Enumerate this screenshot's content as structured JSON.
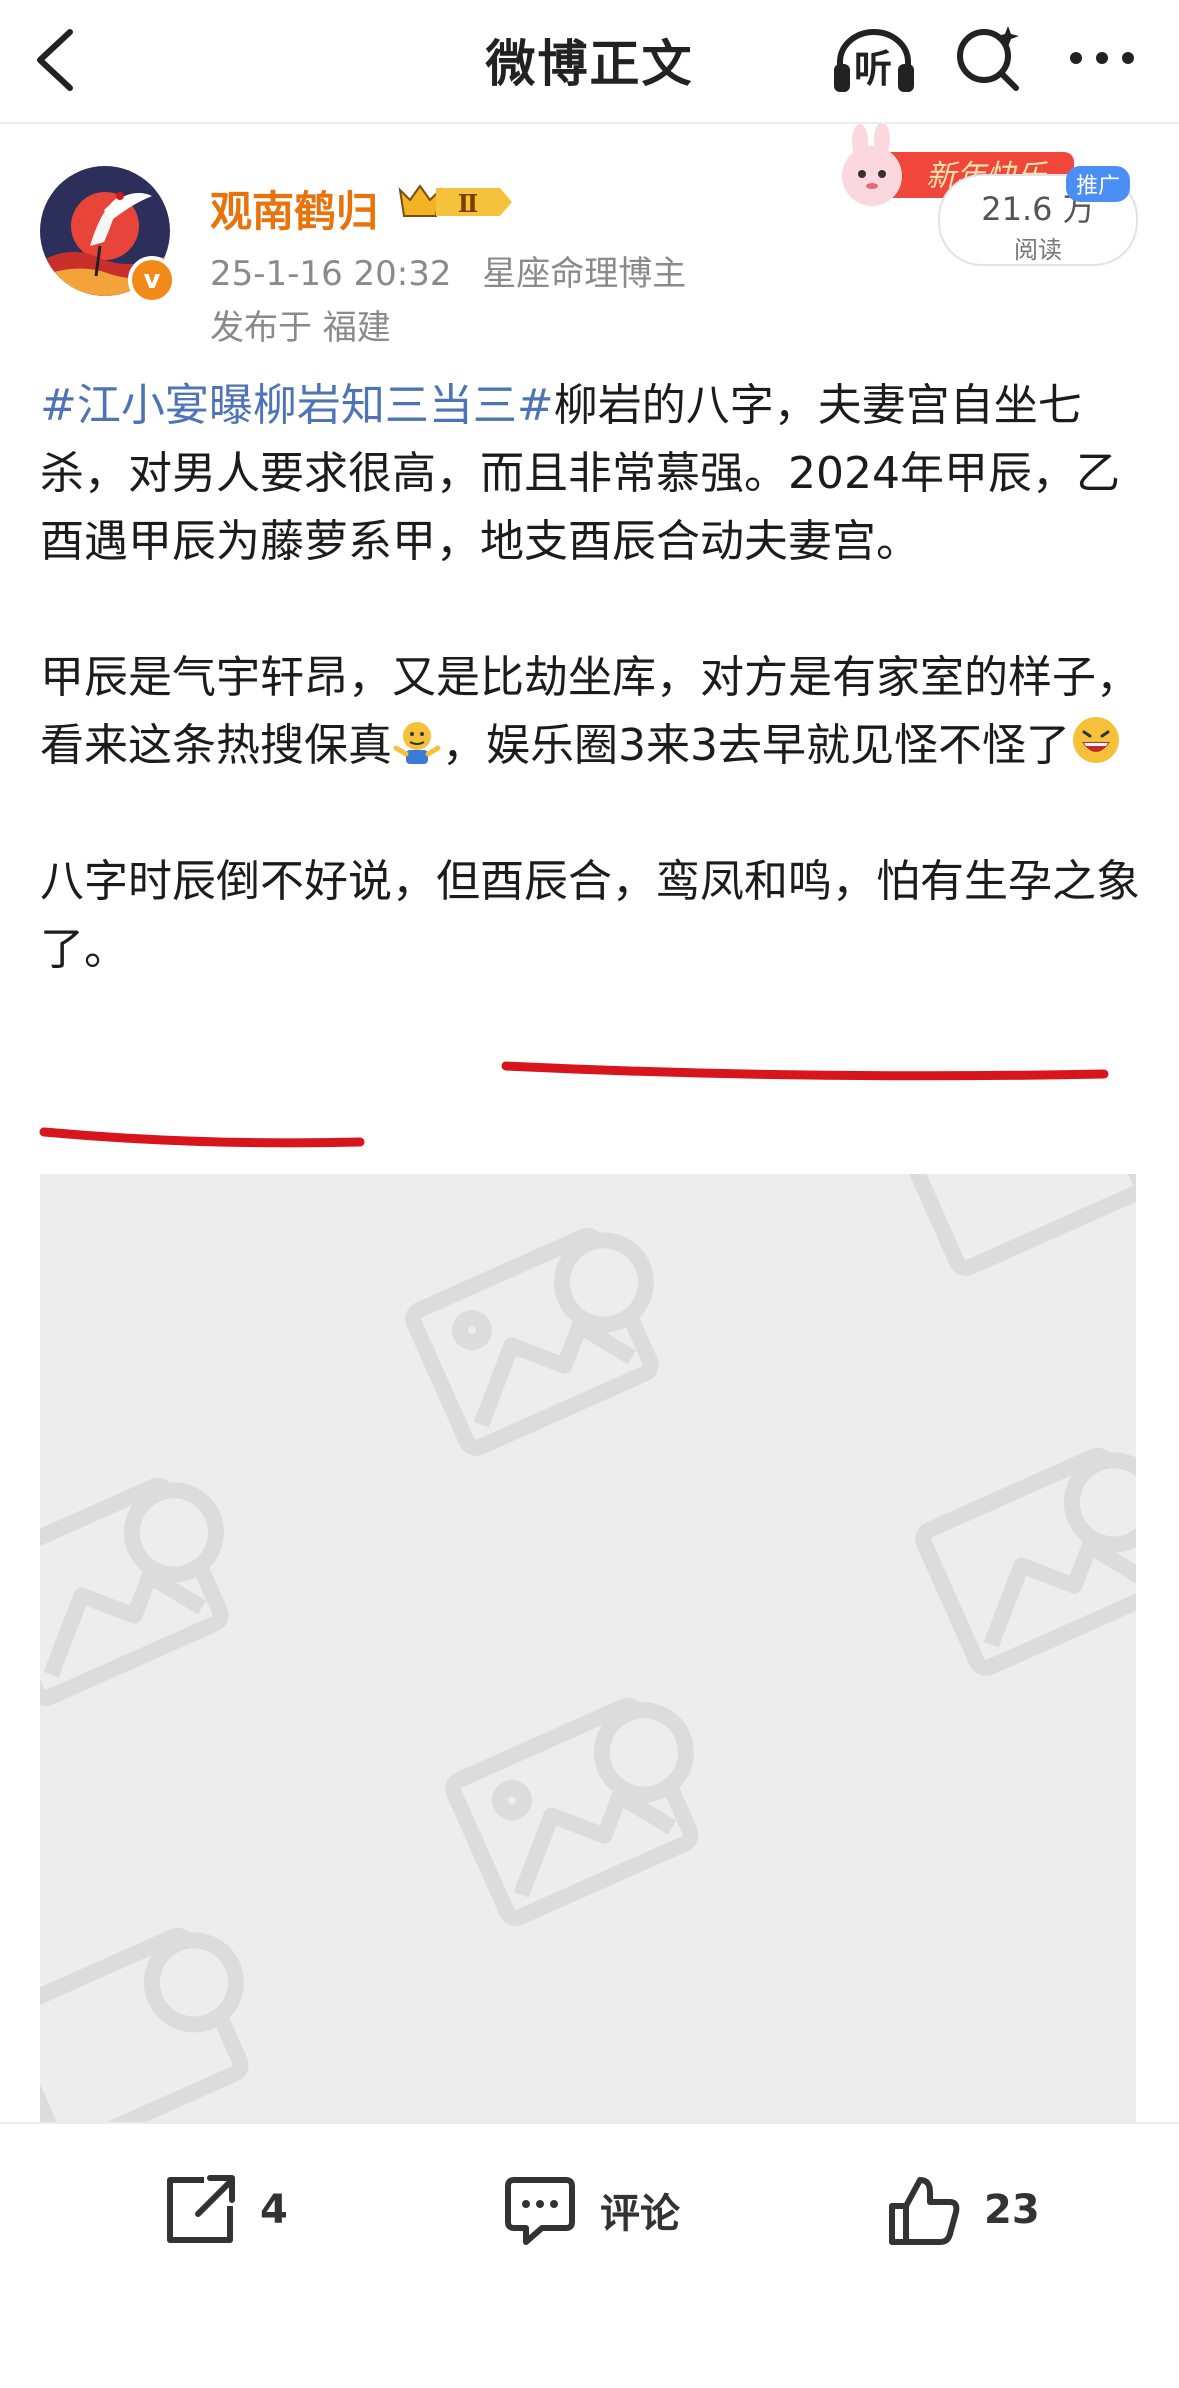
{
  "nav": {
    "title": "微博正文",
    "listen_label": "听"
  },
  "author": {
    "name": "观南鹤归",
    "level": "Ⅱ",
    "time": "25-1-16 20:32",
    "role": "星座命理博主",
    "location": "发布于 福建",
    "verified_mark": "v"
  },
  "promo": {
    "reads": "21.6 万",
    "reads_label": "阅读",
    "tag": "推广"
  },
  "post": {
    "hashtag": "#江小宴曝柳岩知三当三#",
    "p1": "柳岩的八字，夫妻宫自坐七杀，对男人要求很高，而且非常慕强。2024年甲辰，乙酉遇甲辰为藤萝系甲，地支酉辰合动夫妻宫。",
    "p2a": "甲辰是气宇轩昂，又是比劫坐库，对方是有家室的样子，看来这条热搜保真",
    "p2b": "，娱乐圈3来3去早就见怪不怪了",
    "p3": "八字时辰倒不好说，但酉辰合，鸾凤和鸣，怕有生孕之象了。"
  },
  "actions": {
    "share_count": "4",
    "comment_label": "评论",
    "like_count": "23"
  },
  "colors": {
    "hashtag": "#4e74b7",
    "username": "#e8730c",
    "underline": "#d8141c",
    "placeholder_bg": "#ededed"
  }
}
